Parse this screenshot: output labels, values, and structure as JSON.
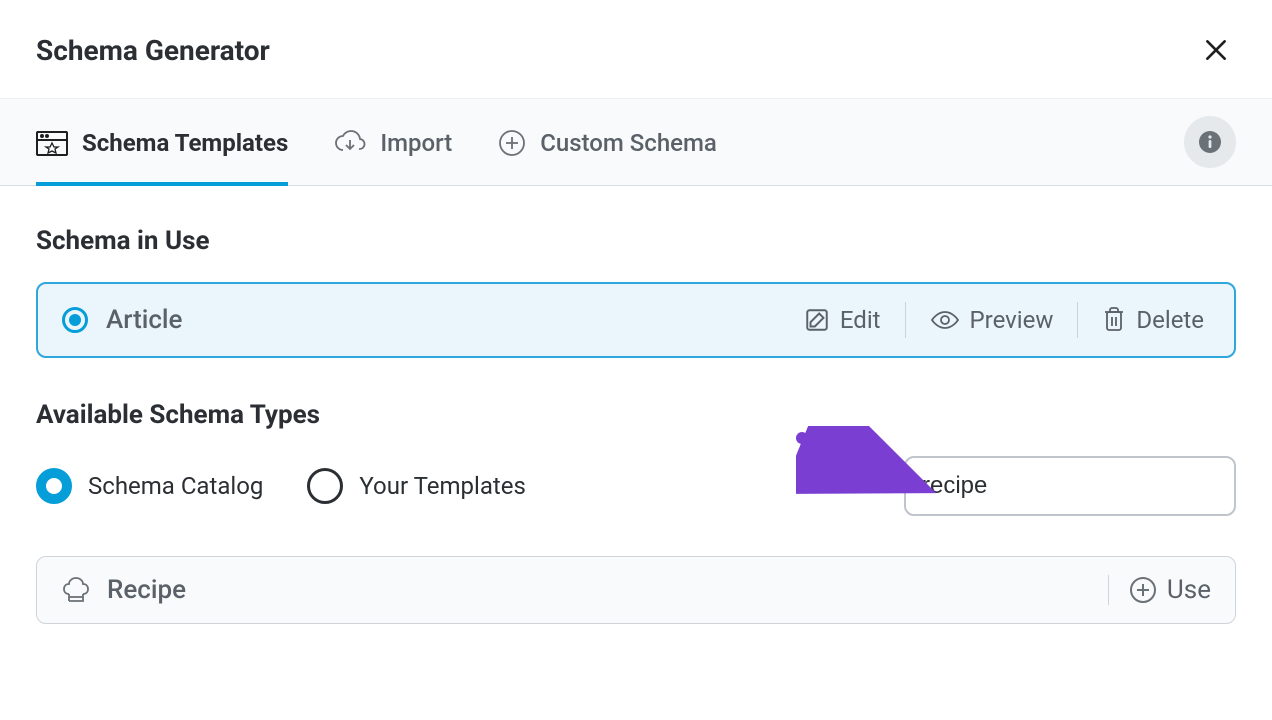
{
  "header": {
    "title": "Schema Generator"
  },
  "tabs": {
    "templates": "Schema Templates",
    "import": "Import",
    "custom": "Custom Schema"
  },
  "sections": {
    "in_use_title": "Schema in Use",
    "available_title": "Available Schema Types"
  },
  "in_use": {
    "name": "Article",
    "actions": {
      "edit": "Edit",
      "preview": "Preview",
      "delete": "Delete"
    }
  },
  "available_toggle": {
    "catalog": "Schema Catalog",
    "your_templates": "Your Templates"
  },
  "search": {
    "value": "recipe"
  },
  "results": {
    "recipe": {
      "name": "Recipe",
      "use_label": "Use"
    }
  }
}
